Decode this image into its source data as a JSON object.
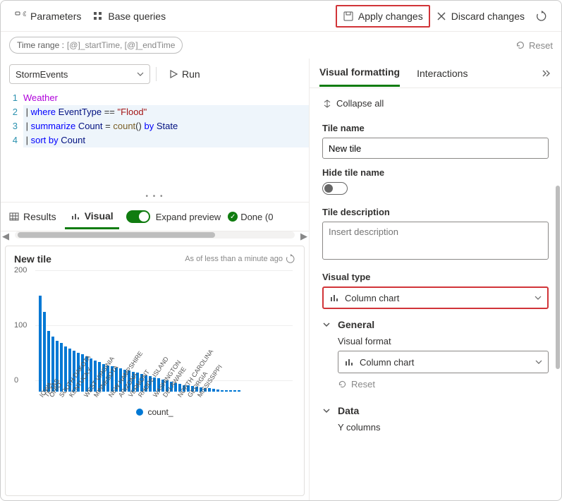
{
  "toolbar": {
    "parameters": "Parameters",
    "base_queries": "Base queries",
    "apply": "Apply changes",
    "discard": "Discard changes"
  },
  "time_range": {
    "label": "Time range :",
    "value": "[@]_startTime, [@]_endTime",
    "reset": "Reset"
  },
  "query": {
    "database": "StormEvents",
    "run": "Run",
    "code": {
      "l1_ident": "Weather",
      "l2_kw": "where",
      "l2_var": "EventType",
      "l2_op": "==",
      "l2_str": "\"Flood\"",
      "l3_kw": "summarize",
      "l3_var": "Count",
      "l3_eq": "=",
      "l3_func": "count",
      "l3_paren": "()",
      "l3_by": "by",
      "l3_col": "State",
      "l4_kw": "sort by",
      "l4_var": "Count"
    },
    "gutter": [
      "1",
      "2",
      "3",
      "4"
    ]
  },
  "results": {
    "tab_results": "Results",
    "tab_visual": "Visual",
    "expand_preview": "Expand preview",
    "done": "Done (0"
  },
  "chart": {
    "title": "New tile",
    "timestamp": "As of less than a minute ago",
    "legend": "count_"
  },
  "chart_data": {
    "type": "bar",
    "title": "New tile",
    "xlabel": "",
    "ylabel": "",
    "ylim": [
      0,
      200
    ],
    "shown_ticks": [
      0,
      100,
      200
    ],
    "series": [
      {
        "name": "count_",
        "values": [
          175,
          145,
          110,
          100,
          92,
          88,
          82,
          78,
          74,
          70,
          68,
          64,
          60,
          56,
          54,
          50,
          48,
          46,
          44,
          42,
          40,
          38,
          36,
          34,
          32,
          30,
          28,
          26,
          24,
          22,
          20,
          18,
          16,
          14,
          12,
          11,
          10,
          9,
          8,
          7,
          6,
          5,
          4,
          3,
          3,
          2,
          2,
          2
        ]
      }
    ],
    "categories": [
      "IOWA",
      "TEXAS",
      "OHIO",
      "",
      "SOUTH DAKOTA",
      "",
      "KENTUCKY",
      "",
      "",
      "WEST VIRGINIA",
      "",
      "MINNESOTA",
      "",
      "",
      "NEW HAMPSHIRE",
      "",
      "ARIZONA",
      "",
      "VERMONT",
      "",
      "RHODE ISLAND",
      "",
      "",
      "WASHINGTON",
      "",
      "DELAWARE",
      "",
      "",
      "NORTH CAROLINA",
      "",
      "GEORGIA",
      "",
      "MISSISSIPPI",
      "",
      "",
      "",
      "",
      "",
      "",
      "",
      "",
      "",
      "",
      "",
      "",
      "",
      "",
      ""
    ]
  },
  "right": {
    "tab_visual_formatting": "Visual formatting",
    "tab_interactions": "Interactions",
    "collapse_all": "Collapse all",
    "tile_name_label": "Tile name",
    "tile_name_value": "New tile",
    "hide_tile_label": "Hide tile name",
    "tile_desc_label": "Tile description",
    "tile_desc_placeholder": "Insert description",
    "visual_type_label": "Visual type",
    "visual_type_value": "Column chart",
    "general_label": "General",
    "visual_format_label": "Visual format",
    "visual_format_value": "Column chart",
    "reset": "Reset",
    "data_label": "Data",
    "y_columns_label": "Y columns"
  },
  "colors": {
    "accent": "#107c10",
    "primary": "#0078d4",
    "danger": "#d13438"
  }
}
